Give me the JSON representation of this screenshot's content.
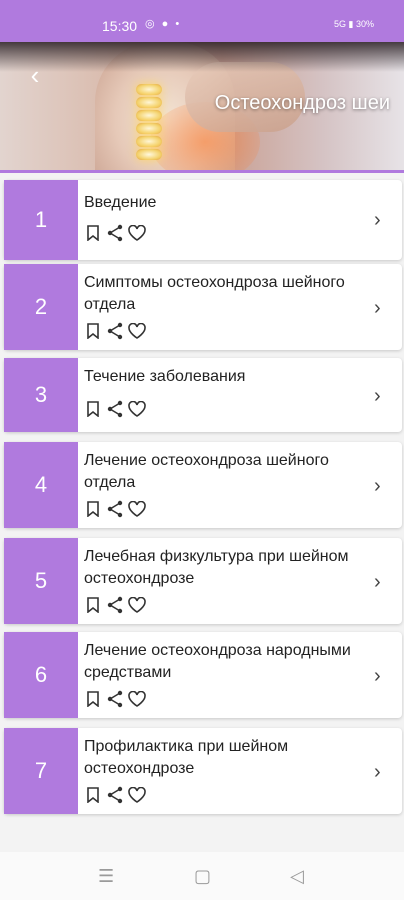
{
  "status": {
    "time": "15:30",
    "notif_icons": "◎ ● •",
    "sys": "5G ▮ 30%"
  },
  "header": {
    "title": "Остеохондроз шеи"
  },
  "items": [
    {
      "num": "1",
      "title": "Введение"
    },
    {
      "num": "2",
      "title": "Симптомы остеохондроза шейного отдела"
    },
    {
      "num": "3",
      "title": "Течение заболевания"
    },
    {
      "num": "4",
      "title": "Лечение остеохондроза шейного отдела"
    },
    {
      "num": "5",
      "title": "Лечебная физкультура при шейном остеохондрозе"
    },
    {
      "num": "6",
      "title": "Лечение остеохондроза народными средствами"
    },
    {
      "num": "7",
      "title": "Профилактика при шейном остеохондрозе"
    }
  ],
  "icons": {
    "bookmark": "bookmark-icon",
    "share": "share-icon",
    "favorite": "heart-icon",
    "chevron": "chevron-right-icon",
    "back": "back-arrow-icon"
  },
  "colors": {
    "accent": "#b07ade"
  }
}
